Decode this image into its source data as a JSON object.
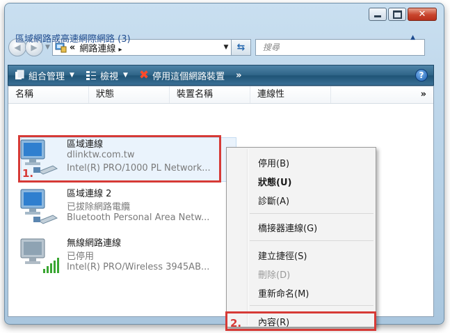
{
  "address": {
    "prefix": "«",
    "path": "網路連線",
    "separator": "▸"
  },
  "search": {
    "placeholder": "搜尋"
  },
  "toolbar": {
    "organize": "組合管理",
    "views": "檢視",
    "disable": "停用這個網路裝置",
    "more": "»",
    "help": "?"
  },
  "columns": [
    "名稱",
    "狀態",
    "裝置名稱",
    "連線性"
  ],
  "columns_more": "»",
  "group": {
    "title": "區域網路或高速網際網路 (3)"
  },
  "connections": [
    {
      "name": "區域連線",
      "status": "dlinktw.com.tw",
      "device": "Intel(R) PRO/1000 PL Network..."
    },
    {
      "name": "區域連線 2",
      "status": "已拔除網路電纜",
      "device": "Bluetooth Personal Area Netw..."
    },
    {
      "name": "無線網路連線",
      "status": "已停用",
      "device": "Intel(R) PRO/Wireless 3945AB..."
    }
  ],
  "context_menu": {
    "disable": "停用(B)",
    "status": "狀態(U)",
    "diagnose": "診斷(A)",
    "bridge": "橋接器連線(G)",
    "shortcut": "建立捷徑(S)",
    "delete": "刪除(D)",
    "rename": "重新命名(M)",
    "properties": "內容(R)"
  },
  "annotations": {
    "step1": "1.",
    "step2": "2."
  },
  "colors": {
    "highlight": "#d63a36",
    "toolbar": "#2f6487"
  }
}
